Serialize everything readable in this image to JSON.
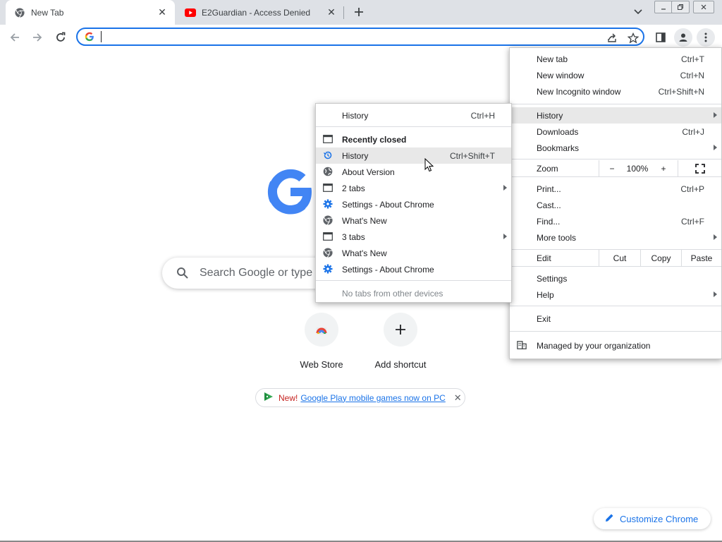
{
  "tabs": [
    {
      "title": "New Tab",
      "icon": "chrome-icon"
    },
    {
      "title": "E2Guardian - Access Denied",
      "icon": "youtube-icon"
    }
  ],
  "omnibox": {
    "value": ""
  },
  "ntp": {
    "search_placeholder": "Search Google or type a URL",
    "shortcuts": [
      {
        "label": "Web Store",
        "icon": "webstore-icon"
      },
      {
        "label": "Add shortcut",
        "icon": "plus-icon"
      }
    ],
    "promo": {
      "new_label": "New!",
      "link_text": "Google Play mobile games now on PC"
    },
    "customize_label": "Customize Chrome"
  },
  "main_menu": {
    "new_tab": {
      "label": "New tab",
      "shortcut": "Ctrl+T"
    },
    "new_window": {
      "label": "New window",
      "shortcut": "Ctrl+N"
    },
    "new_incognito": {
      "label": "New Incognito window",
      "shortcut": "Ctrl+Shift+N"
    },
    "history": {
      "label": "History"
    },
    "downloads": {
      "label": "Downloads",
      "shortcut": "Ctrl+J"
    },
    "bookmarks": {
      "label": "Bookmarks"
    },
    "zoom": {
      "label": "Zoom",
      "minus": "−",
      "value": "100%",
      "plus": "+"
    },
    "print": {
      "label": "Print...",
      "shortcut": "Ctrl+P"
    },
    "cast": {
      "label": "Cast..."
    },
    "find": {
      "label": "Find...",
      "shortcut": "Ctrl+F"
    },
    "more_tools": {
      "label": "More tools"
    },
    "edit": {
      "label": "Edit",
      "cut": "Cut",
      "copy": "Copy",
      "paste": "Paste"
    },
    "settings": {
      "label": "Settings"
    },
    "help": {
      "label": "Help"
    },
    "exit": {
      "label": "Exit"
    },
    "managed": {
      "label": "Managed by your organization"
    }
  },
  "history_submenu": {
    "history": {
      "label": "History",
      "shortcut": "Ctrl+H"
    },
    "recently_closed": "Recently closed",
    "items": [
      {
        "label": "History",
        "shortcut": "Ctrl+Shift+T",
        "icon": "history-icon",
        "arrow": false
      },
      {
        "label": "About Version",
        "shortcut": "",
        "icon": "globe-icon",
        "arrow": false
      },
      {
        "label": "2 tabs",
        "shortcut": "",
        "icon": "window-icon",
        "arrow": true
      },
      {
        "label": "Settings - About Chrome",
        "shortcut": "",
        "icon": "settings-gear-icon",
        "arrow": false
      },
      {
        "label": "What's New",
        "shortcut": "",
        "icon": "chrome-icon",
        "arrow": false
      },
      {
        "label": "3 tabs",
        "shortcut": "",
        "icon": "window-icon",
        "arrow": true
      },
      {
        "label": "What's New",
        "shortcut": "",
        "icon": "chrome-icon",
        "arrow": false
      },
      {
        "label": "Settings - About Chrome",
        "shortcut": "",
        "icon": "settings-gear-icon",
        "arrow": false
      }
    ],
    "no_tabs": "No tabs from other devices"
  }
}
